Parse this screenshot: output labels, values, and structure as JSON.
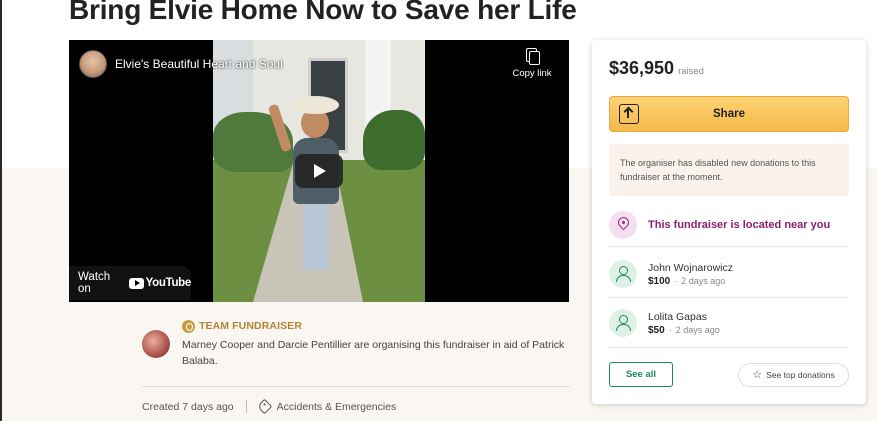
{
  "page": {
    "title": "Bring Elvie Home Now to Save her Life"
  },
  "video": {
    "channel_title": "Elvie's Beautiful Heart and Soul",
    "copy_link_label": "Copy link",
    "watch_on_label": "Watch on",
    "youtube_word": "YouTube",
    "play_icon": "play-icon"
  },
  "organiser": {
    "team_label": "TEAM FUNDRAISER",
    "description": "Marney Cooper and Darcie Pentillier are organising this fundraiser in aid of Patrick Balaba."
  },
  "meta": {
    "created": "Created 7 days ago",
    "category": "Accidents & Emergencies"
  },
  "donation_card": {
    "amount": "$36,950",
    "raised_label": "raised",
    "share_label": "Share",
    "notice": "The organiser has disabled new donations to this fundraiser at the moment.",
    "near_label": "This fundraiser is located near you",
    "donors": [
      {
        "name": "John Wojnarowicz",
        "amount": "$100",
        "time": "2 days ago"
      },
      {
        "name": "Lolita Gapas",
        "amount": "$50",
        "time": "2 days ago"
      }
    ],
    "see_all_label": "See all",
    "see_top_label": "See top donations"
  },
  "colors": {
    "share_button": "#f5b94a",
    "near_text": "#8a1f6c",
    "donor_accent": "#1e8a56",
    "team_accent": "#b48536"
  }
}
